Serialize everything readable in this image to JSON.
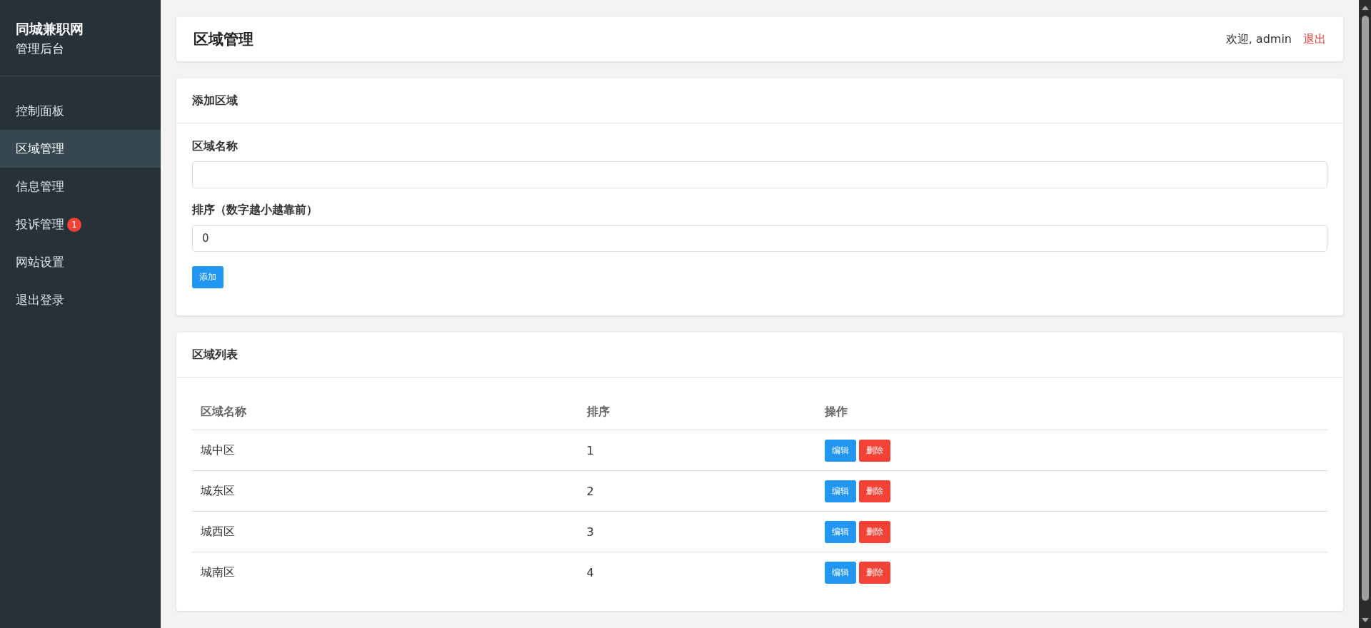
{
  "sidebar": {
    "brand": "同城兼职网",
    "subtitle": "管理后台",
    "items": [
      {
        "label": "控制面板",
        "selected": false
      },
      {
        "label": "区域管理",
        "selected": true
      },
      {
        "label": "信息管理",
        "selected": false
      },
      {
        "label": "投诉管理",
        "selected": false,
        "badge": "1"
      },
      {
        "label": "网站设置",
        "selected": false
      },
      {
        "label": "退出登录",
        "selected": false
      }
    ]
  },
  "header": {
    "title": "区域管理",
    "welcome": "欢迎, admin",
    "logout": "退出"
  },
  "add_form": {
    "title": "添加区域",
    "fields": [
      {
        "label": "区域名称"
      },
      {
        "label": "排序（数字越小越靠前）",
        "value": "0"
      }
    ],
    "button": "添加"
  },
  "list": {
    "title": "区域列表",
    "columns": [
      "区域名称",
      "排序",
      "操作"
    ],
    "rows": [
      {
        "name": "城中区",
        "sort": "1",
        "actions": [
          {
            "label": "编辑",
            "kind": "edit"
          },
          {
            "label": "删除",
            "kind": "delete"
          }
        ]
      },
      {
        "name": "城东区",
        "sort": "2",
        "actions": [
          {
            "label": "编辑",
            "kind": "edit"
          },
          {
            "label": "删除",
            "kind": "delete"
          }
        ]
      },
      {
        "name": "城西区",
        "sort": "3",
        "actions": [
          {
            "label": "编辑",
            "kind": "edit"
          },
          {
            "label": "删除",
            "kind": "delete"
          }
        ]
      },
      {
        "name": "城南区",
        "sort": "4",
        "actions": [
          {
            "label": "编辑",
            "kind": "edit"
          },
          {
            "label": "删除",
            "kind": "delete"
          }
        ]
      }
    ]
  }
}
